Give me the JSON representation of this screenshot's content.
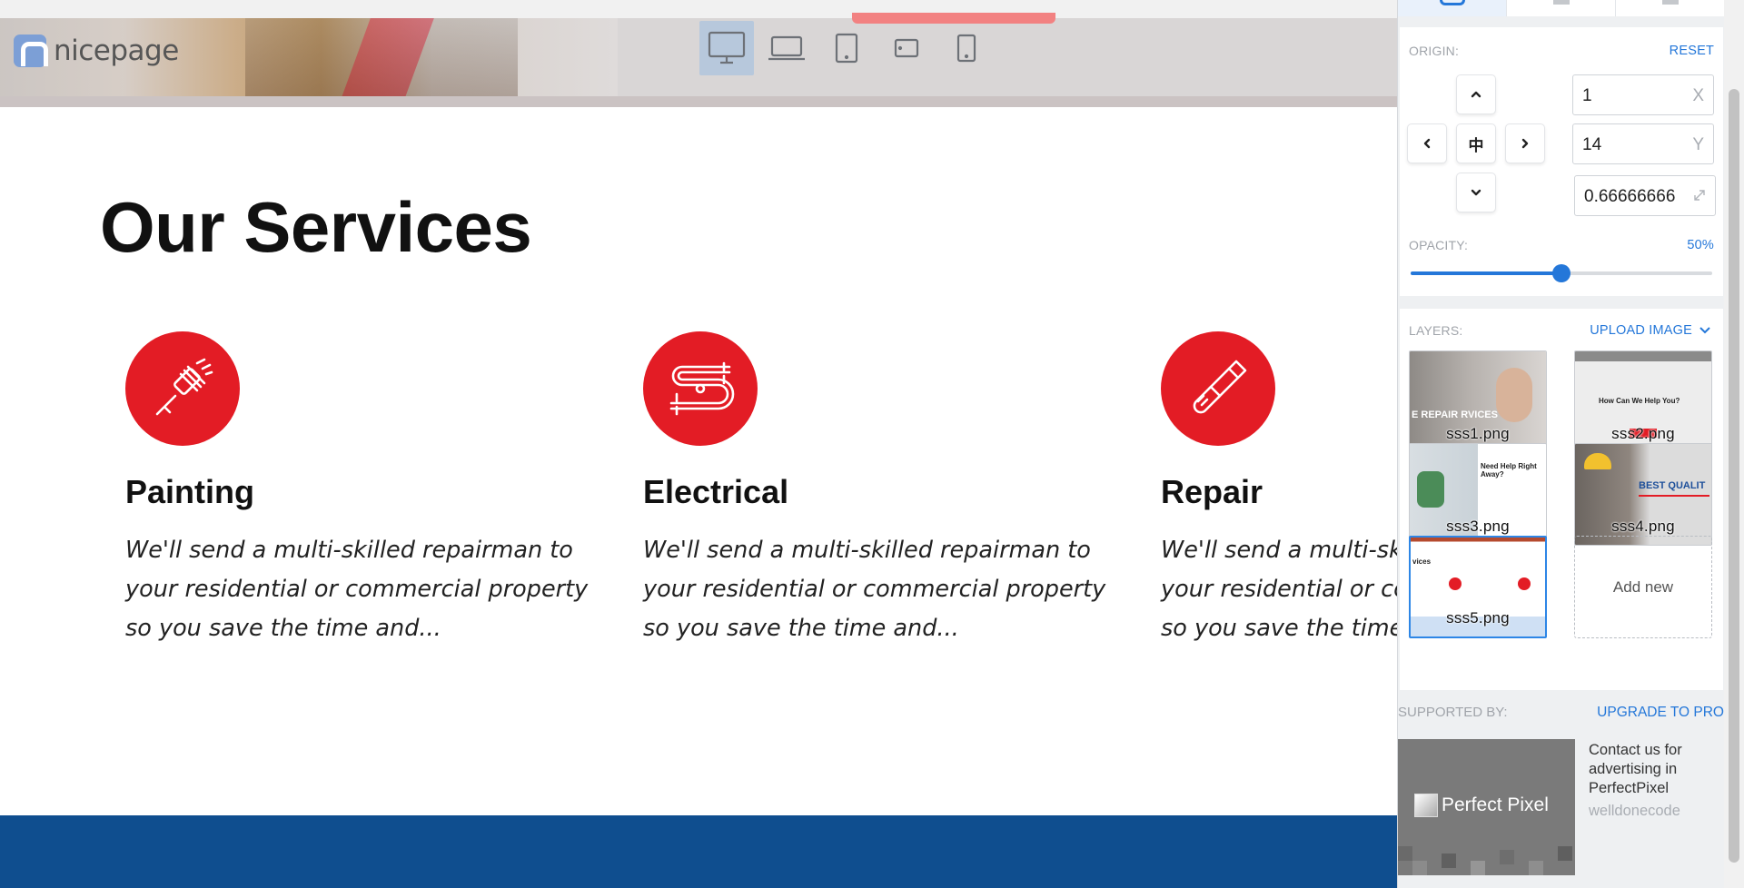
{
  "header": {
    "logo_text": "nicepage",
    "devices": [
      {
        "name": "desktop",
        "active": true
      },
      {
        "name": "laptop",
        "active": false
      },
      {
        "name": "tablet",
        "active": false
      },
      {
        "name": "tablet-landscape",
        "active": false
      },
      {
        "name": "phone",
        "active": false
      }
    ]
  },
  "services": {
    "title": "Our Services",
    "items": [
      {
        "title": "Painting",
        "text": "We'll send a multi-skilled repairman to\nyour residential or commercial property\nso you save the time and...",
        "icon": "paint-roller-icon"
      },
      {
        "title": "Electrical",
        "text": "We'll send a multi-skilled repairman to\nyour residential or commercial property\nso you save the time and...",
        "icon": "electrical-wires-icon"
      },
      {
        "title": "Repair",
        "text": "We'll send a multi-skilled repairman to\nyour residential or commercial property\nso you save the time and...",
        "icon": "screwdriver-icon"
      }
    ]
  },
  "panel": {
    "origin": {
      "label": "ORIGIN:",
      "reset_label": "RESET",
      "x_value": "1",
      "x_axis": "X",
      "y_value": "14",
      "y_axis": "Y",
      "scale_value": "0.66666666",
      "center_glyph": "中"
    },
    "opacity": {
      "label": "OPACITY:",
      "value_text": "50%",
      "value": 0.5
    },
    "layers": {
      "label": "LAYERS:",
      "upload_label": "UPLOAD IMAGE",
      "items": [
        {
          "name": "sss1.png",
          "selected": false,
          "overlay_text": "E REPAIR RVICES"
        },
        {
          "name": "sss2.png",
          "selected": false,
          "overlay_text": "How Can We Help You?"
        },
        {
          "name": "sss3.png",
          "selected": false,
          "overlay_text": "Need Help Right Away?"
        },
        {
          "name": "sss4.png",
          "selected": false,
          "overlay_text": "BEST QUALIT"
        },
        {
          "name": "sss5.png",
          "selected": true,
          "overlay_text": "vices"
        }
      ],
      "add_new_label": "Add new"
    },
    "support": {
      "label": "SUPPORTED BY:",
      "upgrade_label": "UPGRADE TO PRO",
      "ad_brand": "Perfect Pixel",
      "ad_copy": "Contact us for advertising in PerfectPixel",
      "ad_author": "welldonecode"
    }
  },
  "colors": {
    "accent": "#e31c25",
    "link_blue": "#2477d9",
    "footer_band": "#0f4e8f"
  }
}
